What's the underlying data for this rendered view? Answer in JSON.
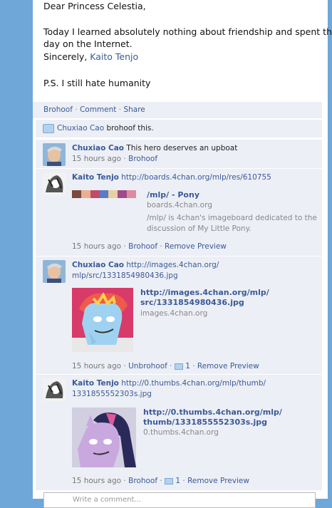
{
  "letter": {
    "greeting": "Dear Princess Celestia,",
    "body_line1": "Today I learned absolutely nothing about friendship and spent the",
    "body_line2": "day on the Internet.",
    "sign_off": "Sincerely,",
    "sign_name": "Kaito Tenjo",
    "ps": "P.S. I still hate humanity"
  },
  "actions": {
    "brohoof": "Brohoof",
    "comment": "Comment",
    "share": "Share",
    "sep": "·"
  },
  "likes": {
    "name": "Chuxiao Cao",
    "text": "brohoof this."
  },
  "comments": [
    {
      "author": "Chuxiao Cao",
      "text": "This hero deserves an upboat",
      "time": "15 hours ago",
      "action1": "Brohoof"
    },
    {
      "author": "Kaito Tenjo",
      "url": "http://boards.4chan.org/mlp/res/610755",
      "preview_title": "/mlp/ - Pony",
      "preview_domain": "boards.4chan.org",
      "preview_desc_line1": "/mlp/ is 4chan's imageboard dedicated to the",
      "preview_desc_line2": "discussion of My Little Pony.",
      "time": "15 hours ago",
      "action1": "Brohoof",
      "action2": "Remove Preview"
    },
    {
      "author": "Chuxiao Cao",
      "url_line1": "http://images.4chan.org/",
      "url_line2": "mlp/src/1331854980436.jpg",
      "preview_title_line1": "http://images.4chan.org/mlp/",
      "preview_title_line2": "src/1331854980436.jpg",
      "preview_domain": "images.4chan.org",
      "time": "15 hours ago",
      "action1": "Unbrohoof",
      "count": "1",
      "action2": "Remove Preview"
    },
    {
      "author": "Kaito Tenjo",
      "url_line1": "http://0.thumbs.4chan.org/mlp/thumb/",
      "url_line2": "1331855552303s.jpg",
      "preview_title_line1": "http://0.thumbs.4chan.org/mlp/",
      "preview_title_line2": "thumb/1331855552303s.jpg",
      "preview_domain": "0.thumbs.4chan.org",
      "time": "15 hours ago",
      "action1": "Brohoof",
      "count": "1",
      "action2": "Remove Preview"
    }
  ],
  "comment_box": {
    "placeholder": "Write a comment..."
  },
  "colors": {
    "link": "#3b5998",
    "panel_bg": "#eceff5",
    "page_bg": "#6fa7d8"
  }
}
